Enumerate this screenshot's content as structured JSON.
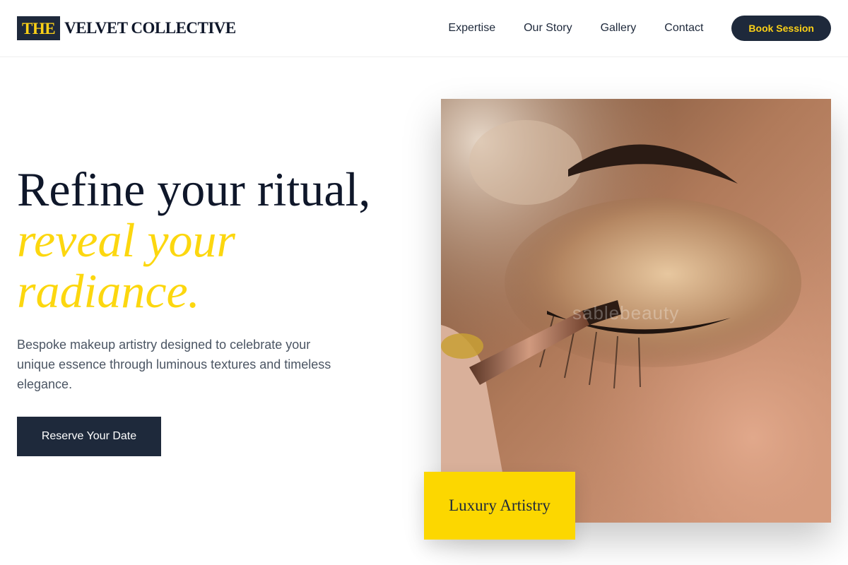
{
  "brand": {
    "badge": "THE",
    "name": "VELVET COLLECTIVE"
  },
  "nav": {
    "links": [
      "Expertise",
      "Our Story",
      "Gallery",
      "Contact"
    ],
    "cta": "Book Session"
  },
  "hero": {
    "title_line1": "Refine your ritual,",
    "title_line2": "reveal your",
    "title_line3": "radiance.",
    "description": "Bespoke makeup artistry designed to celebrate your unique essence through luminous textures and timeless elegance.",
    "cta": "Reserve Your Date"
  },
  "image": {
    "watermark": "sablebeauty"
  },
  "badge": {
    "label": "Luxury Artistry"
  },
  "colors": {
    "navy": "#1e293b",
    "gold": "#fcd700",
    "text_gray": "#4b5563"
  }
}
